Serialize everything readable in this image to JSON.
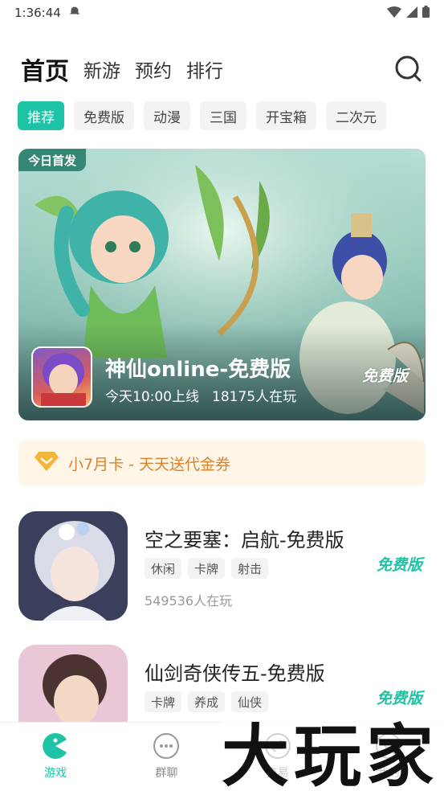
{
  "status_bar": {
    "time": "1:36:44"
  },
  "top_nav": {
    "tabs": [
      {
        "label": "首页",
        "active": true
      },
      {
        "label": "新游",
        "active": false
      },
      {
        "label": "预约",
        "active": false
      },
      {
        "label": "排行",
        "active": false
      }
    ],
    "search_icon": "search-icon"
  },
  "chips": [
    "推荐",
    "免费版",
    "动漫",
    "三国",
    "开宝箱",
    "二次元"
  ],
  "banner": {
    "tag": "今日首发",
    "title": "神仙online-免费版",
    "launch_time": "今天10:00上线",
    "players": "18175人在玩",
    "badge": "免费版"
  },
  "promo": {
    "text": "小7月卡 - 天天送代金券",
    "icon": "diamond-icon"
  },
  "games": [
    {
      "title": "空之要塞：启航-免费版",
      "tags": [
        "休闲",
        "卡牌",
        "射击"
      ],
      "players": "549536人在玩",
      "badge": "免费版"
    },
    {
      "title": "仙剑奇侠传五-免费版",
      "tags": [
        "卡牌",
        "养成",
        "仙侠"
      ],
      "players": "",
      "badge": "免费版"
    }
  ],
  "bottom_nav": [
    {
      "label": "游戏",
      "icon": "pacman-icon",
      "active": true
    },
    {
      "label": "群聊",
      "icon": "chat-bubble-icon",
      "active": false
    },
    {
      "label": "交易",
      "icon": "exchange-icon",
      "active": false
    },
    {
      "label": "我的",
      "icon": "profile-icon",
      "active": false
    }
  ],
  "watermark": "大玩家",
  "colors": {
    "accent": "#1ec3a5",
    "promo_text": "#d9822b",
    "promo_bg": "#fff6e8"
  }
}
